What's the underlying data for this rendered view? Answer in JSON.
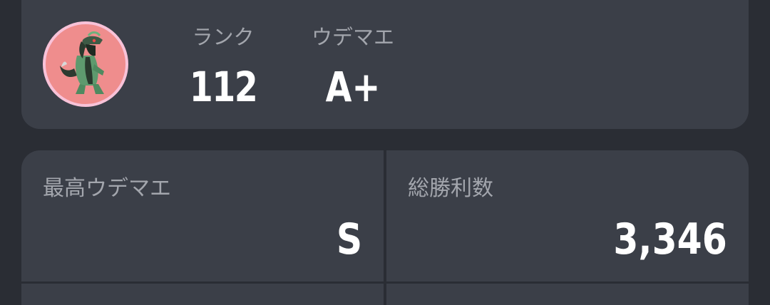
{
  "profile": {
    "avatar_icon": "lizard-character-icon",
    "rank_label": "ランク",
    "rank_value": "112",
    "udemae_label": "ウデマエ",
    "udemae_value": "A+"
  },
  "stats": {
    "max_udemae_label": "最高ウデマエ",
    "max_udemae_value": "S",
    "total_wins_label": "総勝利数",
    "total_wins_value": "3,346"
  },
  "colors": {
    "background": "#2a2d34",
    "card": "#3b3f48",
    "label": "#a3a6ad",
    "value": "#ffffff",
    "avatar_bg": "#ef8d8d",
    "avatar_ring": "#f8c2d8"
  }
}
